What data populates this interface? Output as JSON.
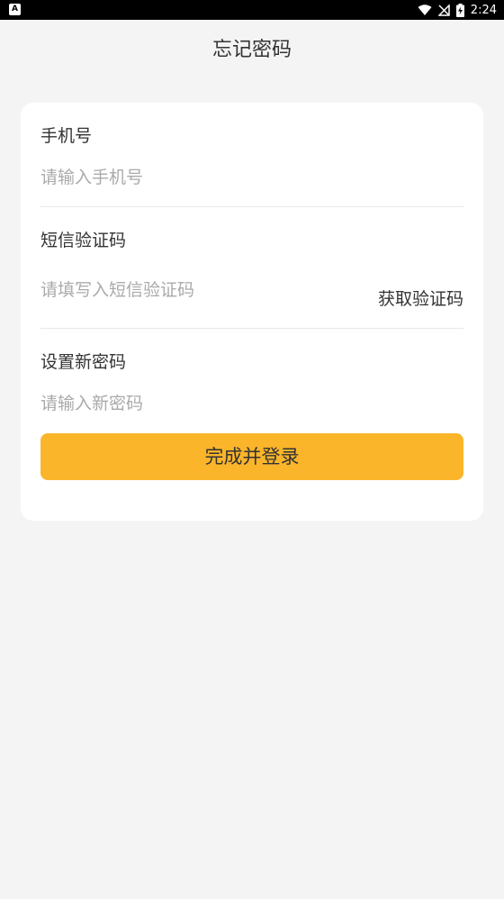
{
  "status_bar": {
    "left_icon_label": "A",
    "time": "2:24",
    "icons": [
      "wifi-icon",
      "no-signal-icon",
      "battery-charging-icon"
    ]
  },
  "page": {
    "title": "忘记密码"
  },
  "form": {
    "phone": {
      "label": "手机号",
      "placeholder": "请输入手机号"
    },
    "sms_code": {
      "label": "短信验证码",
      "placeholder": "请填写入短信验证码",
      "get_code_label": "获取验证码"
    },
    "new_password": {
      "label": "设置新密码",
      "placeholder": "请输入新密码"
    },
    "submit_label": "完成并登录"
  },
  "colors": {
    "background": "#f4f4f4",
    "card": "#ffffff",
    "accent": "#fbb52a"
  }
}
